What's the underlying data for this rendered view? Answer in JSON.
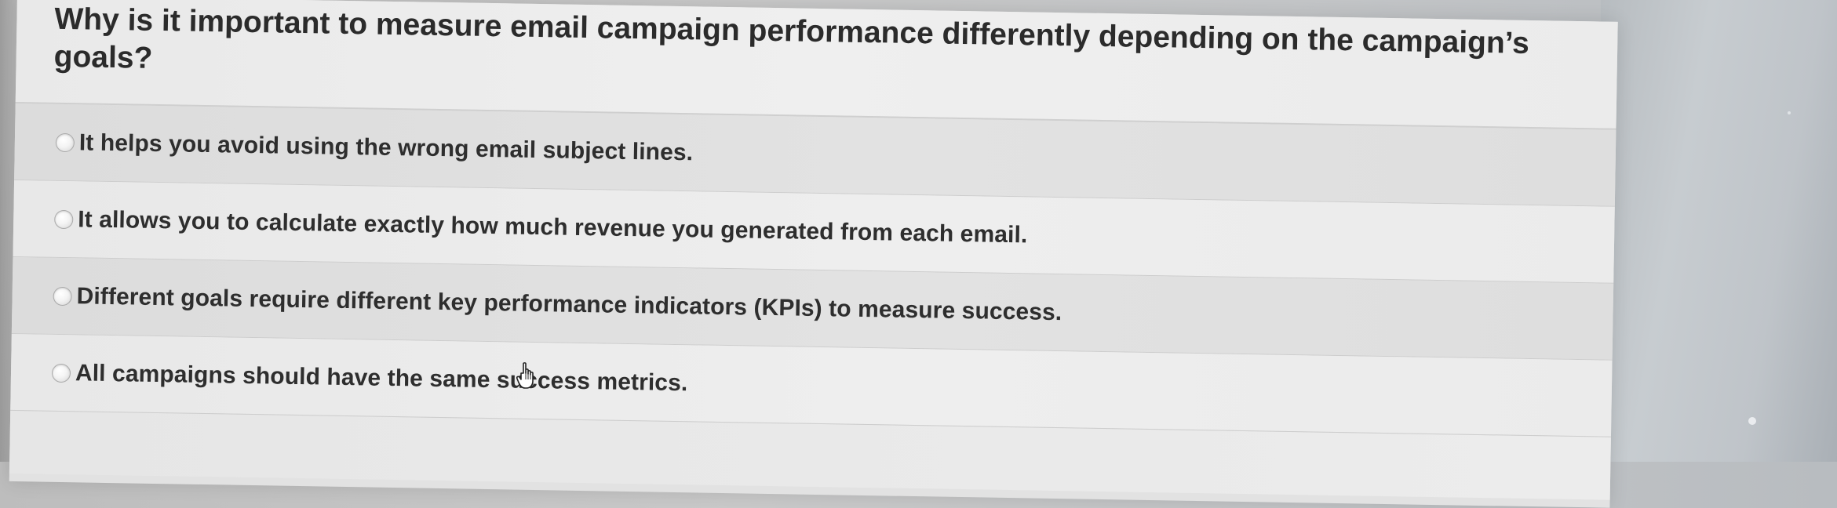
{
  "question": {
    "text": "Why is it important to measure email campaign performance differently depending on the campaign’s goals?"
  },
  "options": [
    {
      "label": "It helps you avoid using the wrong email subject lines."
    },
    {
      "label": "It allows you to calculate exactly how much revenue you generated from each email."
    },
    {
      "label": "Different goals require different key performance indicators (KPIs) to measure success."
    },
    {
      "label": "All campaigns should have the same success metrics."
    }
  ]
}
